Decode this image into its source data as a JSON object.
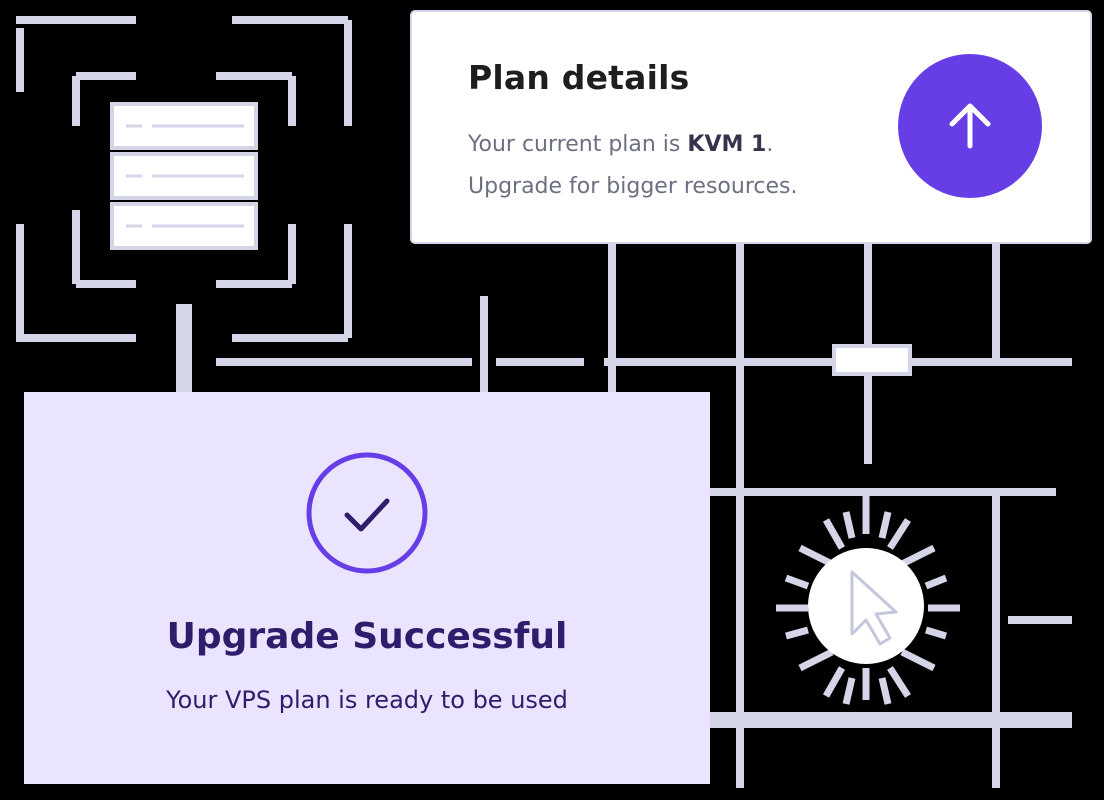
{
  "plan_card": {
    "title": "Plan details",
    "line1_prefix": "Your current plan is ",
    "plan_name": "KVM 1",
    "line1_suffix": ".",
    "line2": "Upgrade for bigger resources.",
    "upgrade_icon": "arrow-up-icon"
  },
  "success_card": {
    "icon": "check-icon",
    "title": "Upgrade Successful",
    "subtitle": "Your VPS plan is ready to be used"
  },
  "decor": {
    "server_icon": "server-rack-icon",
    "cursor_icon": "cursor-pointer-icon"
  },
  "colors": {
    "background": "#000000",
    "accent": "#673de6",
    "line": "#d5d5e8",
    "success_bg": "#ebe4ff",
    "success_text": "#2f1c6a"
  }
}
